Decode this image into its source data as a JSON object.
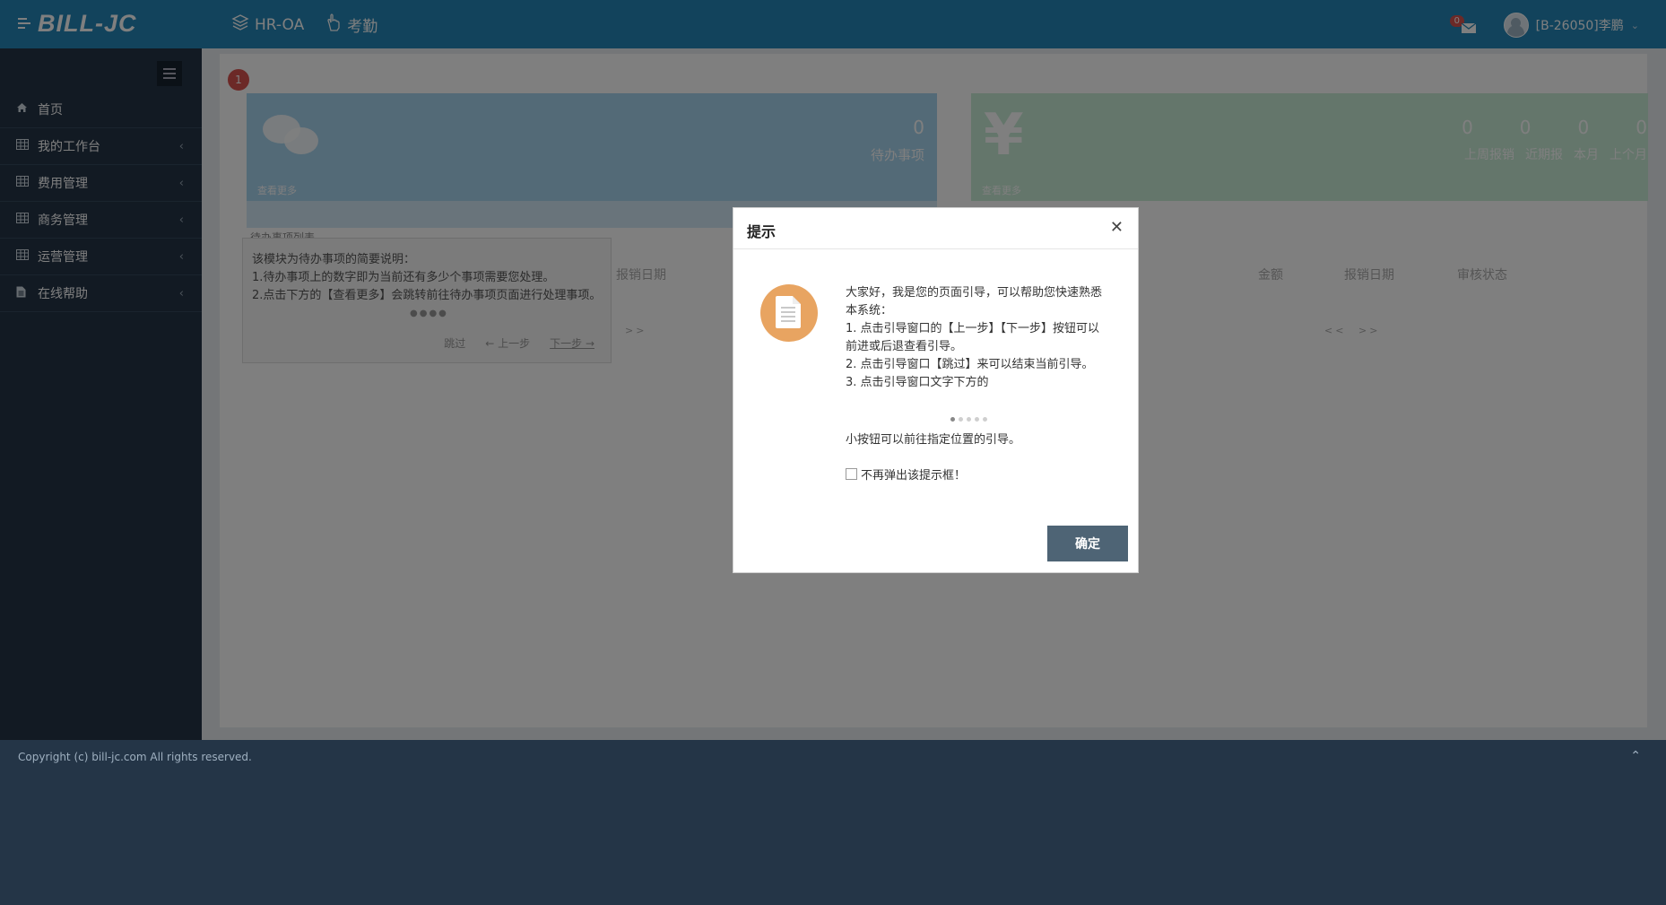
{
  "header": {
    "logo_text": "BILL-JC",
    "nav": [
      {
        "label": "HR-OA",
        "icon": "layers-icon"
      },
      {
        "label": "考勤",
        "icon": "hand-pointer-icon"
      }
    ],
    "mail_count": "0",
    "user_label": "[B-26050]李鹏"
  },
  "sidebar": {
    "items": [
      {
        "label": "首页",
        "icon": "home-icon"
      },
      {
        "label": "我的工作台",
        "icon": "table-icon"
      },
      {
        "label": "费用管理",
        "icon": "table-icon"
      },
      {
        "label": "商务管理",
        "icon": "table-icon"
      },
      {
        "label": "运营管理",
        "icon": "table-icon"
      },
      {
        "label": "在线帮助",
        "icon": "file-icon"
      }
    ]
  },
  "background": {
    "step_number": "1",
    "todo_count": "0",
    "todo_label": "待办事项",
    "more_label": "查看更多",
    "sub_title": "待办事项列表",
    "tip_title": "该模块为待办事项的简要说明：",
    "tip_line1": "1.待办事项上的数字即为当前还有多少个事项需要您处理。",
    "tip_line2": "2.点击下方的【查看更多】会跳转前往待办事项页面进行处理事项。",
    "tip_buttons": [
      "跳过",
      "← 上一步",
      "下一步 →"
    ],
    "col_apply_date": "报销日期",
    "col_amount": "金额",
    "col_reimburse_date": "报销日期",
    "col_status": "审核状态",
    "pager_next": ">>",
    "pager_prev": "<<",
    "money_values": [
      "0",
      "0",
      "0",
      "0"
    ],
    "money_labels": [
      "上周报销",
      "近期报",
      "本月",
      "上个月"
    ]
  },
  "modal": {
    "title": "提示",
    "para": [
      "大家好，我是您的页面引导，可以帮助您快速熟悉本系统：",
      "1. 点击引导窗口的【上一步】【下一步】按钮可以前进或后退查看引导。",
      "2. 点击引导窗口【跳过】来可以结束当前引导。",
      "3. 点击引导窗口文字下方的"
    ],
    "tail": "小按钮可以前往指定位置的引导。",
    "checkbox_label": "不再弹出该提示框！",
    "ok_label": "确定"
  },
  "footer": {
    "copyright": "Copyright (c) bill-jc.com All rights reserved."
  }
}
